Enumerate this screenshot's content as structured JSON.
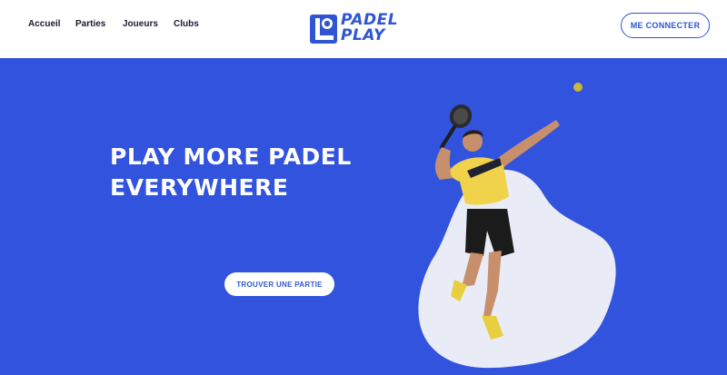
{
  "header": {
    "nav": [
      {
        "label": "Accueil"
      },
      {
        "label": "Parties"
      },
      {
        "label": "Joueurs"
      },
      {
        "label": "Clubs"
      }
    ],
    "logo": {
      "line1": "PADEL",
      "line2": "PLAY"
    },
    "login_label": "ME CONNECTER"
  },
  "hero": {
    "title_line1": "PLAY MORE PADEL",
    "title_line2": "EVERYWHERE",
    "cta_label": "TROUVER UNE PARTIE",
    "image": "padel-player-jumping"
  },
  "colors": {
    "brand_blue": "#3153dd",
    "logo_blue": "#2f55d4",
    "blob": "#e9ecf7",
    "shirt": "#f0d34a",
    "ball": "#c9b837"
  }
}
